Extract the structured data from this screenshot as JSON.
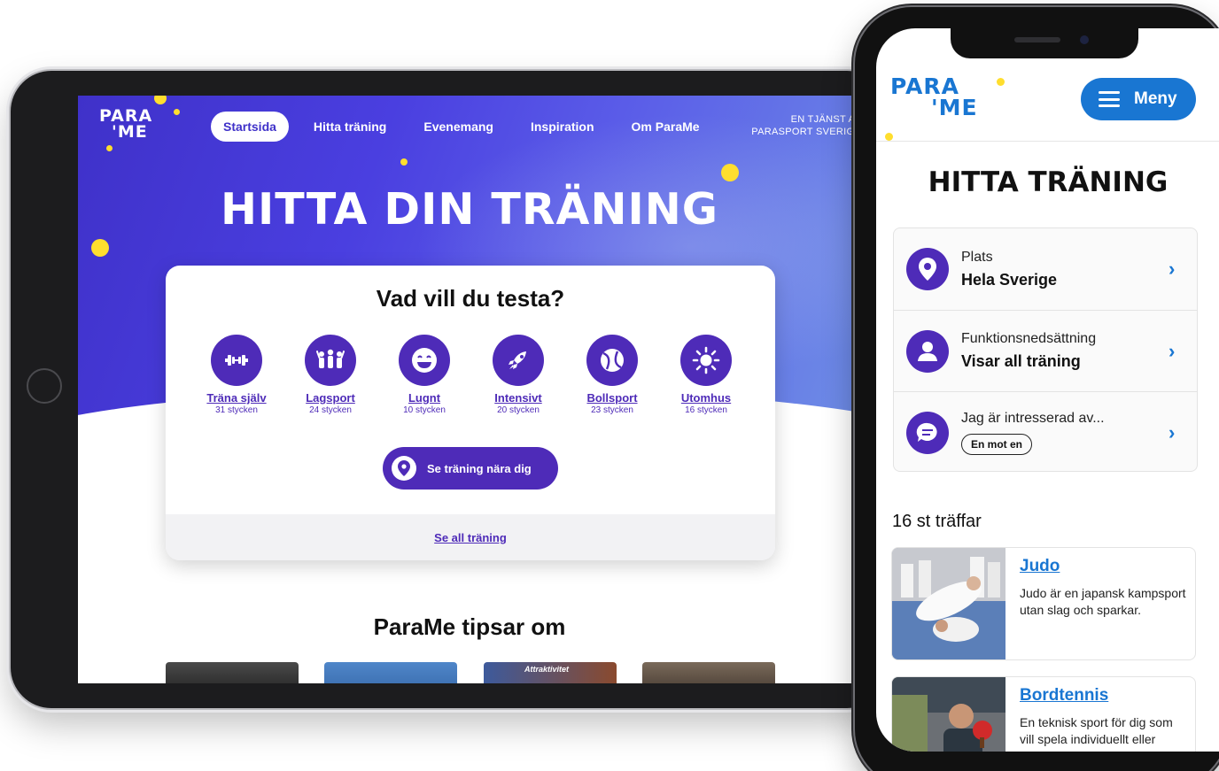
{
  "tablet": {
    "logo_line1": "PARA",
    "logo_line2": "'ME",
    "nav": [
      {
        "label": "Startsida",
        "active": true
      },
      {
        "label": "Hitta träning"
      },
      {
        "label": "Evenemang"
      },
      {
        "label": "Inspiration"
      },
      {
        "label": "Om ParaMe"
      }
    ],
    "service_line1": "EN TJÄNST AV",
    "service_line2": "PARASPORT SVERIGE",
    "hero_title": "HITTA DIN TRÄNING",
    "card": {
      "title": "Vad vill du testa?",
      "categories": [
        {
          "name": "Träna själv",
          "count": "31 stycken",
          "icon": "dumbbell-icon"
        },
        {
          "name": "Lagsport",
          "count": "24 stycken",
          "icon": "team-icon"
        },
        {
          "name": "Lugnt",
          "count": "10 stycken",
          "icon": "smiley-icon"
        },
        {
          "name": "Intensivt",
          "count": "20 stycken",
          "icon": "rocket-icon"
        },
        {
          "name": "Bollsport",
          "count": "23 stycken",
          "icon": "ball-icon"
        },
        {
          "name": "Utomhus",
          "count": "16 stycken",
          "icon": "sun-icon"
        }
      ],
      "near_button": "Se träning nära dig",
      "all_link": "Se all träning"
    },
    "tips_title": "ParaMe tipsar om",
    "tips_thumb_label": "Attraktivitet",
    "colors": {
      "brand_purple": "#4e2bb8",
      "hero_blue": "#4a3fe0",
      "accent_yellow": "#ffde2e"
    }
  },
  "phone": {
    "logo_line1": "PARA",
    "logo_line2": "'ME",
    "menu_label": "Meny",
    "title": "HITTA TRÄNING",
    "filters": [
      {
        "label": "Plats",
        "value": "Hela Sverige",
        "icon": "location-pin-icon"
      },
      {
        "label": "Funktionsnedsättning",
        "value": "Visar all träning",
        "icon": "person-icon"
      },
      {
        "label": "Jag är intresserad av...",
        "pill": "En mot en",
        "icon": "chat-bubble-icon"
      }
    ],
    "hits": "16 st träffar",
    "results": [
      {
        "title": "Judo",
        "desc": "Judo är en japansk kampsport utan slag och sparkar."
      },
      {
        "title": "Bordtennis",
        "desc": "En teknisk sport för dig som vill spela individuellt eller tillsammans med"
      }
    ],
    "colors": {
      "brand_blue": "#1976d2"
    }
  }
}
